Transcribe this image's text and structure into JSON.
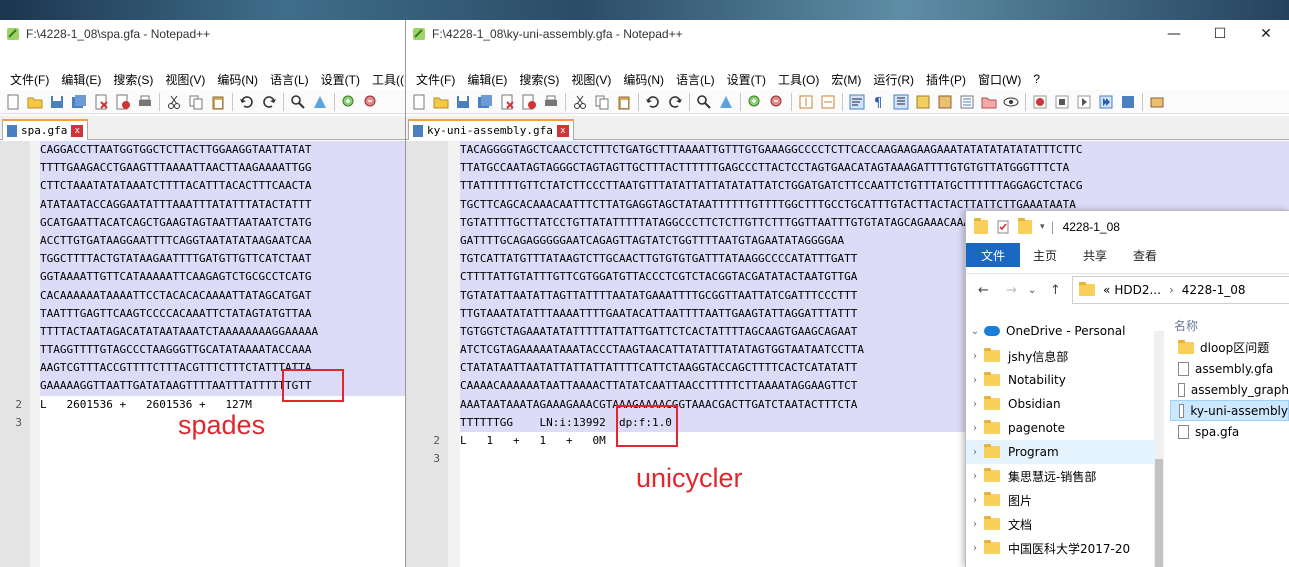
{
  "left_window": {
    "title": "F:\\4228-1_08\\spa.gfa - Notepad++",
    "menu": [
      "文件(F)",
      "编辑(E)",
      "搜索(S)",
      "视图(V)",
      "编码(N)",
      "语言(L)",
      "设置(T)",
      "工具(("
    ],
    "tab_label": "spa.gfa",
    "tab_close": "x",
    "seq_lines": [
      "CAGGACCTTAATGGTGGCTCTTACTTGGAAGGTAATTATAT",
      "TTTTGAAGACCTGAAGTTTAAAATTAACTTAAGAAAATTGG",
      "CTTCTAAATATATAAATCTTTTACATTTACACTTTCAACTA",
      "ATATAATACCAGGAATATTTAAATTTATATTTATACTATTT",
      "GCATGAATTACATCAGCTGAAGTAGTAATTAATAATCTATG",
      "ACCTTGTGATAAGGAATTTTCAGGTAATATATAAGAATCAA",
      "TGGCTTTTACTGTATAAGAATTTTGATGTTGTTCATCTAAT",
      "GGTAAAATTGTTCATAAAAATTCAAGAGTCTGCGCCTCATG",
      "CACAAAAAATAAAATTCCTACACACAAAATTATAGCATGAT",
      "TAATTTGAGTTCAAGTCCCCACAAATTCTATAGTATGTTAA",
      "TTTTACTAATAGACATATAATAAATCTAAAAAAAAGGAAAAA",
      "TTAGGTTTTGTAGCCCTAAGGGTTGCATATAAAATACCAAA",
      "AAGTCGTTTACCGTTTTCTTTACGTTTCTTTCTATTTATTA",
      "GAAAAAGGTTAATTGATATAAGTTTTAATTTATTTTTTGTT"
    ],
    "line2_number": "2",
    "line3_number": "3",
    "line2_text": "L   2601536 +   2601536 +   ",
    "line2_value": "127M",
    "annotation": "spades"
  },
  "right_window": {
    "title": "F:\\4228-1_08\\ky-uni-assembly.gfa - Notepad++",
    "menu": [
      "文件(F)",
      "编辑(E)",
      "搜索(S)",
      "视图(V)",
      "编码(N)",
      "语言(L)",
      "设置(T)",
      "工具(O)",
      "宏(M)",
      "运行(R)",
      "插件(P)",
      "窗口(W)",
      "?"
    ],
    "caption_buttons": [
      "—",
      "☐",
      "✕"
    ],
    "tab_label": "ky-uni-assembly.gfa",
    "tab_close": "x",
    "seq_lines": [
      "TACAGGGGTAGCTCAACCTCTTTCTGATGCTTTAAAATTGTTTGTGAAAGGCCCCTCTTCACCAAGAAGAAGAAATATATATATATATTTCTTC",
      "TTATGCCAATAGTAGGGCTAGTAGTTGCTTTACTTTTTTGAGCCCTTACTCCTAGTGAACATAGTAAAGATTTTGTGTGTTATGGGTTTCTA",
      "TTATTTTTTGTTCTATCTTCCCTTAATGTTTATATTATTATATATTATCTGGATGATCTTCCAATTCTGTTTATGCTTTTTTAGGAGCTCTACG",
      "TGCTTCAGCACAAACAATTTCTTATGAGGTAGCTATAATTTTTTGTTTTGGCTTTGCCTGCATTTGTACTTACTACTTATTCTTGAAATAATA",
      "TGTATTTTGCTTATCCTGTTATATTTTTATAGGCCCTTCTCTTGTTCTTTGGTTAATTTGTGTATAGCAGAAACAAACCGAGCCCCTTTT",
      "GATTTTGCAGAGGGGGAATCAGAGTTAGTATCTGGTTTTAATGTAGAATATAGGGGAA",
      "TGTCATTATGTTTATAAGTCTTGCAACTTGTGTGTGATTTATAAGGCCCCATATTTGATT",
      "CTTTTATTGTATTTGTTCGTGGATGTTACCCTCGTCTACGGTACGATATACTAATGTTGA",
      "TGTATATTAATATTAGTTATTTTAATATGAAATTTTGCGGTTAATTATCGATTTCCCTTT",
      "TTGTAAATATATTTAAAATTTTGAATACATTAATTTTAATTGAAGTATTAGGATTTATTT",
      "TGTGGTCTAGAAATATATTTTTATTATTGATTCTCACTATTTTAGCAAGTGAAGCAGAAT",
      "ATCTCGTAGAAAAATAAATACCCTAAGTAACATTATATTTATATAGTGGTAATAATCCTTA",
      "CTATATAATTAATATTATTATTATTTTCATTCTAAGGTACCAGCTTTTCACTCATATATT",
      "CAAAACAAAAAATAATTAAAACTTATATCAATTAACCTTTTTCTTAAAATAGGAAGTTCT",
      "AAATAATAAATAGAAAGAAACGTAAAGAAAACGGTAAACGACTTGATCTAATACTTTCTA",
      "TTTTTTGG    LN:i:13992  dp:f:1.0"
    ],
    "line2_number": "2",
    "line3_number": "3",
    "line2_text": "L   1   +   1   +   ",
    "line2_value": "0M",
    "annotation": "unicycler"
  },
  "explorer": {
    "title": "4228-1_08",
    "ribbon_tabs": [
      "文件",
      "主页",
      "共享",
      "查看"
    ],
    "address_parts": [
      "«",
      "HDD2...",
      "›",
      "4228-1_08"
    ],
    "nav_items": [
      {
        "label": "OneDrive - Personal",
        "kind": "cloud",
        "expand": "⌄"
      },
      {
        "label": "jshy信息部",
        "kind": "folder",
        "expand": "›"
      },
      {
        "label": "Notability",
        "kind": "folder",
        "expand": "›"
      },
      {
        "label": "Obsidian",
        "kind": "folder",
        "expand": "›"
      },
      {
        "label": "pagenote",
        "kind": "folder",
        "expand": "›"
      },
      {
        "label": "Program",
        "kind": "folder",
        "expand": "›",
        "hover": true
      },
      {
        "label": "集思慧远-销售部",
        "kind": "folder",
        "expand": "›"
      },
      {
        "label": "图片",
        "kind": "folder",
        "expand": "›"
      },
      {
        "label": "文档",
        "kind": "folder",
        "expand": "›"
      },
      {
        "label": "中国医科大学2017-20",
        "kind": "folder",
        "expand": "›"
      }
    ],
    "column_header": "名称",
    "files": [
      {
        "label": "dloop区问题",
        "kind": "folder"
      },
      {
        "label": "assembly.gfa",
        "kind": "doc"
      },
      {
        "label": "assembly_graph",
        "kind": "doc"
      },
      {
        "label": "ky-uni-assembly",
        "kind": "doc",
        "selected": true
      },
      {
        "label": "spa.gfa",
        "kind": "doc"
      }
    ]
  },
  "colors": {
    "annotation_red": "#e0272d",
    "selection": "#dcdcf8",
    "explorer_blue": "#1a67c4"
  }
}
